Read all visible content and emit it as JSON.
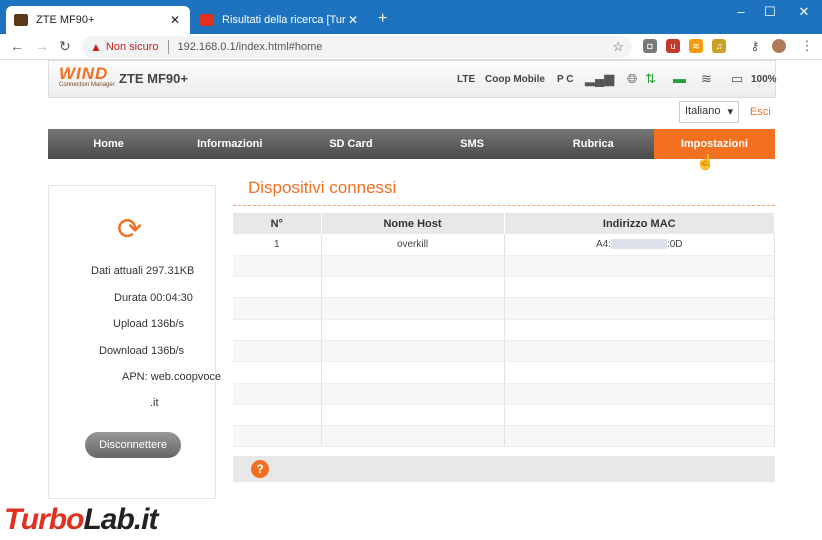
{
  "browser": {
    "tabs": [
      {
        "title": "ZTE MF90+",
        "active": true
      },
      {
        "title": "Risultati della ricerca [TurboLab.i",
        "active": false
      }
    ],
    "new_tab": "+",
    "security_label": "Non sicuro",
    "url": "192.168.0.1/index.html#home",
    "window_controls": [
      "–",
      "☐",
      "✕"
    ]
  },
  "header": {
    "logo_text": "WIND",
    "logo_sub": "Connection Manager",
    "model": "ZTE MF90+",
    "network_type": "LTE",
    "operator": "Coop Mobile",
    "pc": "P C",
    "battery": "100%"
  },
  "language": {
    "selected": "Italiano",
    "logout": "Esci"
  },
  "menu": [
    "Home",
    "Informazioni",
    "SD Card",
    "SMS",
    "Rubrica",
    "Impostazioni"
  ],
  "sidebar": {
    "data_label": "Dati attuali",
    "data_value": "297.31KB",
    "duration_label": "Durata",
    "duration_value": "00:04:30",
    "upload_label": "Upload",
    "upload_value": "136b/s",
    "download_label": "Download",
    "download_value": "136b/s",
    "apn_label": "APN:",
    "apn_value": "web.coopvoce",
    "apn_value2": ".it",
    "disconnect": "Disconnettere"
  },
  "main": {
    "title": "Dispositivi connessi",
    "columns": [
      "N°",
      "Nome Host",
      "Indirizzo MAC"
    ],
    "rows": [
      {
        "n": "1",
        "host": "overkill",
        "mac_start": "A4:",
        "mac_end": ":0D"
      }
    ],
    "help": "?"
  },
  "watermark": {
    "part1": "Turbo",
    "part2": "Lab.it"
  },
  "colors": {
    "accent": "#f37021",
    "titlebar": "#1e73be",
    "warning": "#c5221f"
  }
}
